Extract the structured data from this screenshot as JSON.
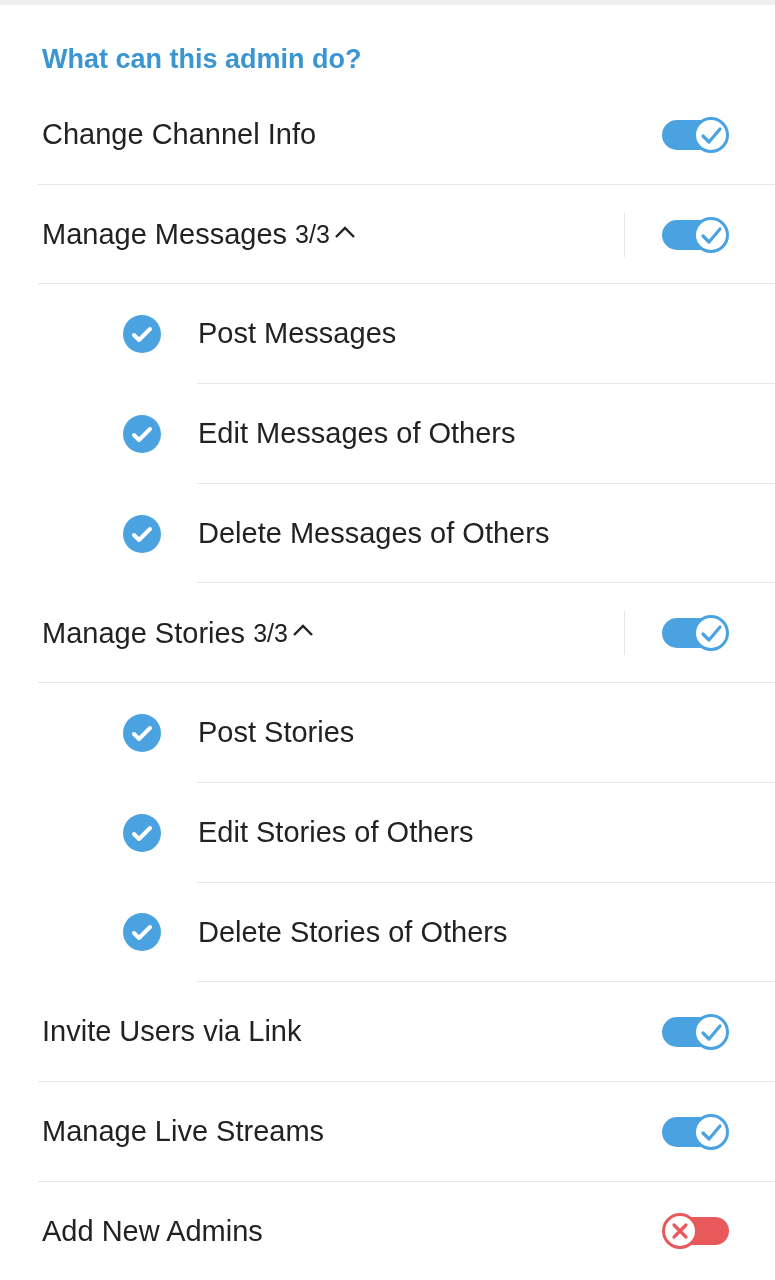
{
  "section_title": "What can this admin do?",
  "permissions": [
    {
      "kind": "toggle",
      "label": "Change Channel Info",
      "on": true
    },
    {
      "kind": "group",
      "label": "Manage Messages",
      "count": "3/3",
      "expanded": true,
      "on": true,
      "children": [
        {
          "label": "Post Messages",
          "checked": true
        },
        {
          "label": "Edit Messages of Others",
          "checked": true
        },
        {
          "label": "Delete Messages of Others",
          "checked": true
        }
      ]
    },
    {
      "kind": "group",
      "label": "Manage Stories",
      "count": "3/3",
      "expanded": true,
      "on": true,
      "children": [
        {
          "label": "Post Stories",
          "checked": true
        },
        {
          "label": "Edit Stories of Others",
          "checked": true
        },
        {
          "label": "Delete Stories of Others",
          "checked": true
        }
      ]
    },
    {
      "kind": "toggle",
      "label": "Invite Users via Link",
      "on": true
    },
    {
      "kind": "toggle",
      "label": "Manage Live Streams",
      "on": true
    },
    {
      "kind": "toggle",
      "label": "Add New Admins",
      "on": false
    }
  ]
}
